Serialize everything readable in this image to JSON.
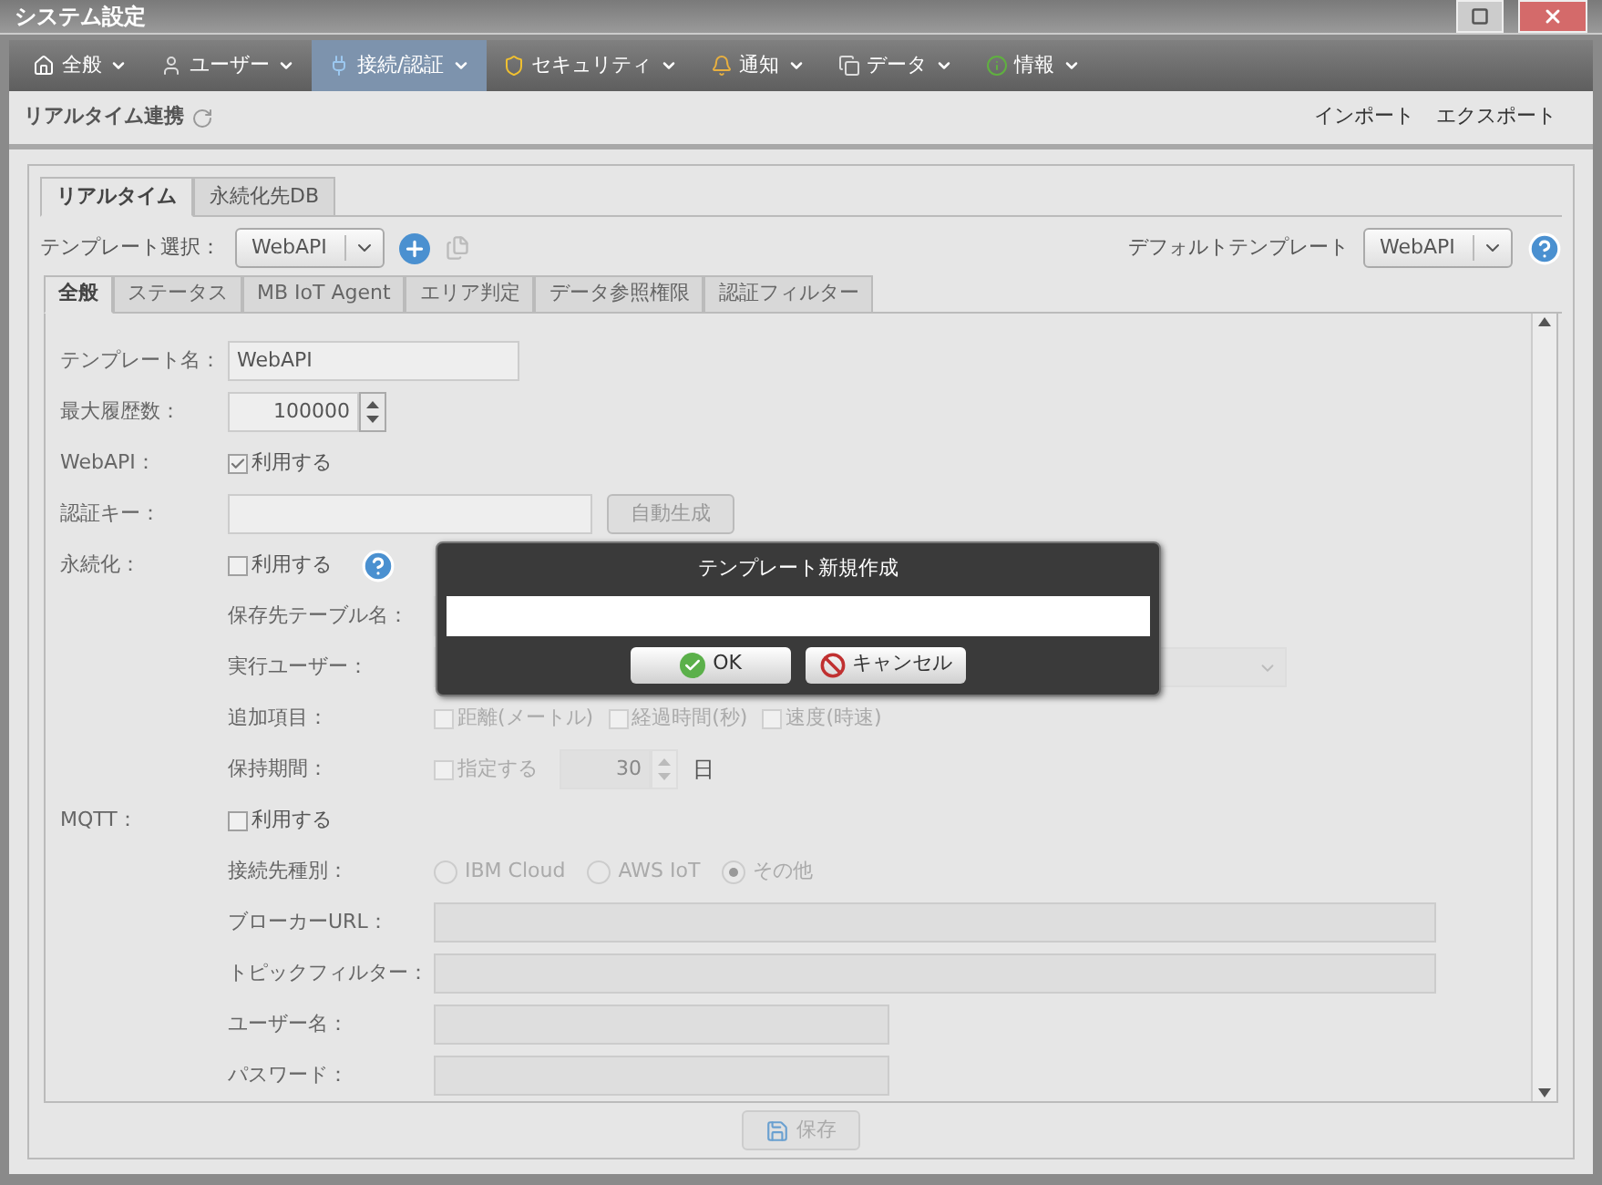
{
  "window": {
    "title": "システム設定"
  },
  "menu": [
    {
      "label": "全般",
      "selected": false
    },
    {
      "label": "ユーザー",
      "selected": false
    },
    {
      "label": "接続/認証",
      "selected": true
    },
    {
      "label": "セキュリティ",
      "selected": false
    },
    {
      "label": "通知",
      "selected": false
    },
    {
      "label": "データ",
      "selected": false
    },
    {
      "label": "情報",
      "selected": false
    }
  ],
  "header": {
    "title": "リアルタイム連携",
    "links": [
      "インポート",
      "エクスポート"
    ]
  },
  "outer_tabs": [
    {
      "label": "リアルタイム",
      "selected": true
    },
    {
      "label": "永続化先DB",
      "selected": false
    }
  ],
  "template_select": {
    "label": "テンプレート選択：",
    "value": "WebAPI"
  },
  "default_template": {
    "label": "デフォルトテンプレート",
    "value": "WebAPI"
  },
  "inner_tabs": [
    {
      "label": "全般",
      "selected": true
    },
    {
      "label": "ステータス",
      "selected": false
    },
    {
      "label": "MB IoT Agent",
      "selected": false
    },
    {
      "label": "エリア判定",
      "selected": false
    },
    {
      "label": "データ参照権限",
      "selected": false
    },
    {
      "label": "認証フィルター",
      "selected": false
    }
  ],
  "form": {
    "template_name": {
      "label": "テンプレート名：",
      "value": "WebAPI"
    },
    "max_history": {
      "label": "最大履歴数：",
      "value": "100000"
    },
    "webapi": {
      "label": "WebAPI：",
      "option": "利用する",
      "checked": true
    },
    "auth_key": {
      "label": "認証キー：",
      "button": "自動生成"
    },
    "persistence": {
      "label": "永続化：",
      "option": "利用する",
      "checked": false,
      "table_label": "保存先テーブル名：",
      "user_label": "実行ユーザー：",
      "extra_label": "追加項目：",
      "extras": [
        {
          "label": "距離(メートル)",
          "checked": false
        },
        {
          "label": "経過時間(秒)",
          "checked": false
        },
        {
          "label": "速度(時速)",
          "checked": false
        }
      ],
      "retention_label": "保持期間：",
      "retention_option": "指定する",
      "retention_checked": false,
      "retention_value": "30",
      "retention_unit": "日"
    },
    "mqtt": {
      "label": "MQTT：",
      "option": "利用する",
      "checked": false,
      "type_label": "接続先種別：",
      "types": [
        {
          "label": "IBM Cloud",
          "selected": false
        },
        {
          "label": "AWS IoT",
          "selected": false
        },
        {
          "label": "その他",
          "selected": true
        }
      ],
      "fields": [
        {
          "label": "ブローカーURL：",
          "wide": true
        },
        {
          "label": "トピックフィルター：",
          "wide": true
        },
        {
          "label": "ユーザー名：",
          "wide": false
        },
        {
          "label": "パスワード：",
          "wide": false
        }
      ]
    }
  },
  "save_button": "保存",
  "dialog": {
    "title": "テンプレート新規作成",
    "buttons": [
      {
        "label": "OK",
        "kind": "ok"
      },
      {
        "label": "キャンセル",
        "kind": "cancel"
      }
    ]
  }
}
